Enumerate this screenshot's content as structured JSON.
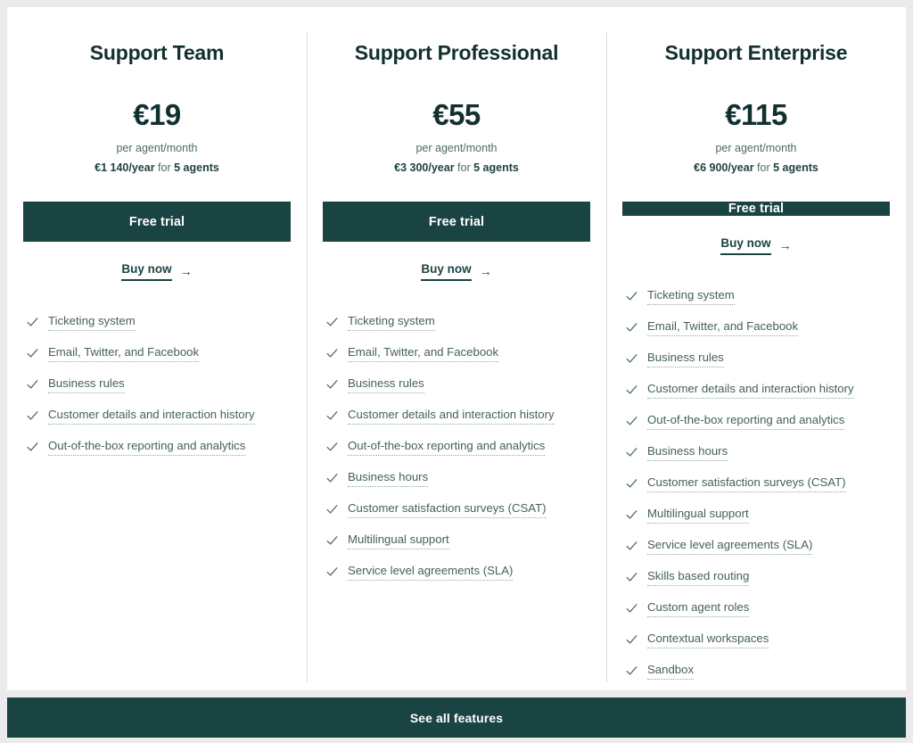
{
  "plans": [
    {
      "title": "Support Team",
      "price": "€19",
      "per_unit": "per agent/month",
      "yearly_amount": "€1 140/year",
      "yearly_mid": " for ",
      "yearly_agents": "5 agents",
      "cta_label": "Free trial",
      "buy_now_label": "Buy now",
      "arrow_icon": "→",
      "features": [
        "Ticketing system",
        "Email, Twitter, and Facebook",
        "Business rules",
        "Customer details and interaction history",
        "Out-of-the-box reporting and analytics"
      ]
    },
    {
      "title": "Support Professional",
      "price": "€55",
      "per_unit": "per agent/month",
      "yearly_amount": "€3 300/year",
      "yearly_mid": " for ",
      "yearly_agents": "5 agents",
      "cta_label": "Free trial",
      "buy_now_label": "Buy now",
      "arrow_icon": "→",
      "features": [
        "Ticketing system",
        "Email, Twitter, and Facebook",
        "Business rules",
        "Customer details and interaction history",
        "Out-of-the-box reporting and analytics",
        "Business hours",
        "Customer satisfaction surveys (CSAT)",
        "Multilingual support",
        "Service level agreements (SLA)"
      ]
    },
    {
      "title": "Support Enterprise",
      "price": "€115",
      "per_unit": "per agent/month",
      "yearly_amount": "€6 900/year",
      "yearly_mid": " for ",
      "yearly_agents": "5 agents",
      "cta_label": "Free trial",
      "buy_now_label": "Buy now",
      "arrow_icon": "→",
      "features": [
        "Ticketing system",
        "Email, Twitter, and Facebook",
        "Business rules",
        "Customer details and interaction history",
        "Out-of-the-box reporting and analytics",
        "Business hours",
        "Customer satisfaction surveys (CSAT)",
        "Multilingual support",
        "Service level agreements (SLA)",
        "Skills based routing",
        "Custom agent roles",
        "Contextual workspaces",
        "Sandbox"
      ]
    }
  ],
  "footer": {
    "see_all_label": "See all features"
  },
  "colors": {
    "accent": "#1a4442",
    "heading": "#11302f",
    "muted": "#4d6a6a",
    "feature_text": "#45605f",
    "divider": "#d8dcdd",
    "page_bg": "#ebebeb",
    "card_bg": "#ffffff"
  }
}
